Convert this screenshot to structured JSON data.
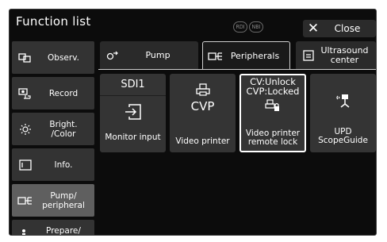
{
  "header": {
    "title": "Function list",
    "badges": [
      "RDI",
      "NBI"
    ],
    "close_label": "Close"
  },
  "sidebar": {
    "items": [
      {
        "label": "Observ.",
        "icon": "observation-icon"
      },
      {
        "label": "Record",
        "icon": "record-icon"
      },
      {
        "label": "Bright.\n/Color",
        "icon": "brightness-icon"
      },
      {
        "label": "Info.",
        "icon": "info-icon"
      },
      {
        "label": "Pump/\nperipheral",
        "icon": "peripheral-icon",
        "active": true
      },
      {
        "label": "Prepare/\nEnd Exam",
        "icon": "prepare-icon"
      }
    ]
  },
  "tabs": [
    {
      "label": "Pump",
      "icon": "pump-icon"
    },
    {
      "label": "Peripherals",
      "icon": "peripheral-icon",
      "active": true
    },
    {
      "label": "Ultrasound\ncenter",
      "icon": "ultrasound-icon"
    }
  ],
  "functions": [
    {
      "top_label": "SDI1",
      "label": "Monitor input",
      "icon": "input-icon"
    },
    {
      "top_label": "CVP",
      "label": "Video printer",
      "icon": "printer-icon"
    },
    {
      "top_label": "CV:Unlock\nCVP:Locked",
      "label": "Video printer\nremote lock",
      "icon": "printer-lock-icon",
      "selected": true
    },
    {
      "top_label": "",
      "label": "UPD\nScopeGuide",
      "icon": "scopeguide-icon"
    }
  ],
  "colors": {
    "background": "#0c0c0c",
    "button": "#343434",
    "active": "#5f5f5f",
    "text": "#ffffff"
  }
}
